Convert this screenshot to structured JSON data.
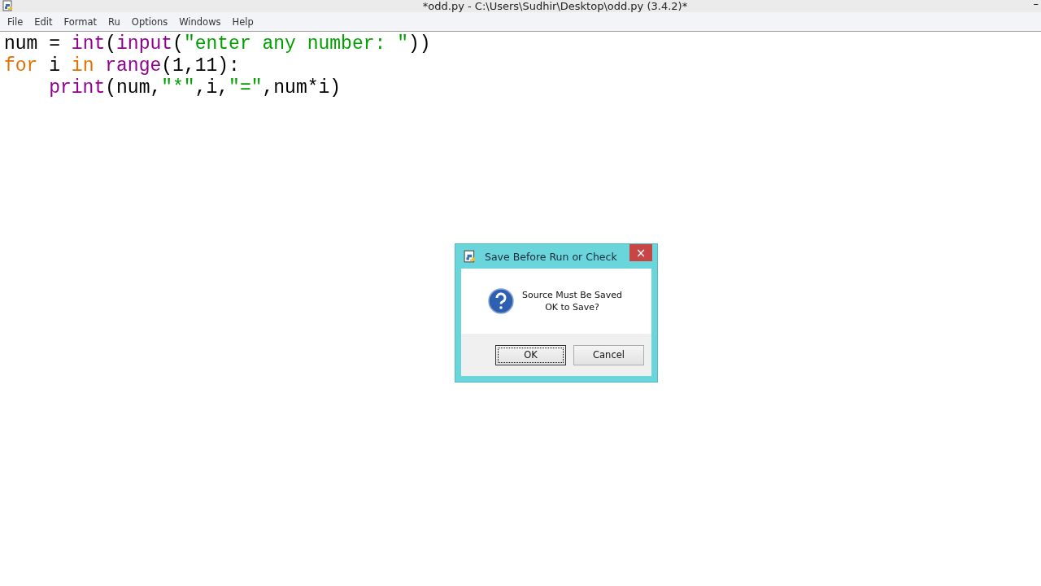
{
  "window": {
    "title": "*odd.py - C:\\Users\\Sudhir\\Desktop\\odd.py (3.4.2)*",
    "minimize": "–"
  },
  "menu": [
    {
      "label": "File"
    },
    {
      "label": "Edit"
    },
    {
      "label": "Format"
    },
    {
      "label": "Ru"
    },
    {
      "label": "Options"
    },
    {
      "label": "Windows"
    },
    {
      "label": "Help"
    }
  ],
  "code": [
    {
      "tokens": [
        {
          "kind": "plain",
          "text": "num = "
        },
        {
          "kind": "builtin",
          "text": "int"
        },
        {
          "kind": "plain",
          "text": "("
        },
        {
          "kind": "builtin",
          "text": "input"
        },
        {
          "kind": "plain",
          "text": "("
        },
        {
          "kind": "string",
          "text": "\"enter any number: \""
        },
        {
          "kind": "plain",
          "text": "))"
        }
      ]
    },
    {
      "tokens": [
        {
          "kind": "keyword",
          "text": "for"
        },
        {
          "kind": "plain",
          "text": " i "
        },
        {
          "kind": "keyword",
          "text": "in"
        },
        {
          "kind": "builtin",
          "text": " range"
        },
        {
          "kind": "plain",
          "text": "(1,11):"
        }
      ]
    },
    {
      "tokens": [
        {
          "kind": "builtin",
          "text": "    print"
        },
        {
          "kind": "plain",
          "text": "(num,"
        },
        {
          "kind": "string",
          "text": "\"*\""
        },
        {
          "kind": "plain",
          "text": ",i,"
        },
        {
          "kind": "string",
          "text": "\"=\""
        },
        {
          "kind": "plain",
          "text": ",num*i)"
        }
      ]
    }
  ],
  "dialog": {
    "title": "Save Before Run or Check",
    "close": "×",
    "message": [
      "Source Must Be Saved",
      "OK to Save?"
    ],
    "buttons": [
      {
        "label": "OK",
        "selected": true
      },
      {
        "label": "Cancel",
        "selected": false
      }
    ]
  }
}
